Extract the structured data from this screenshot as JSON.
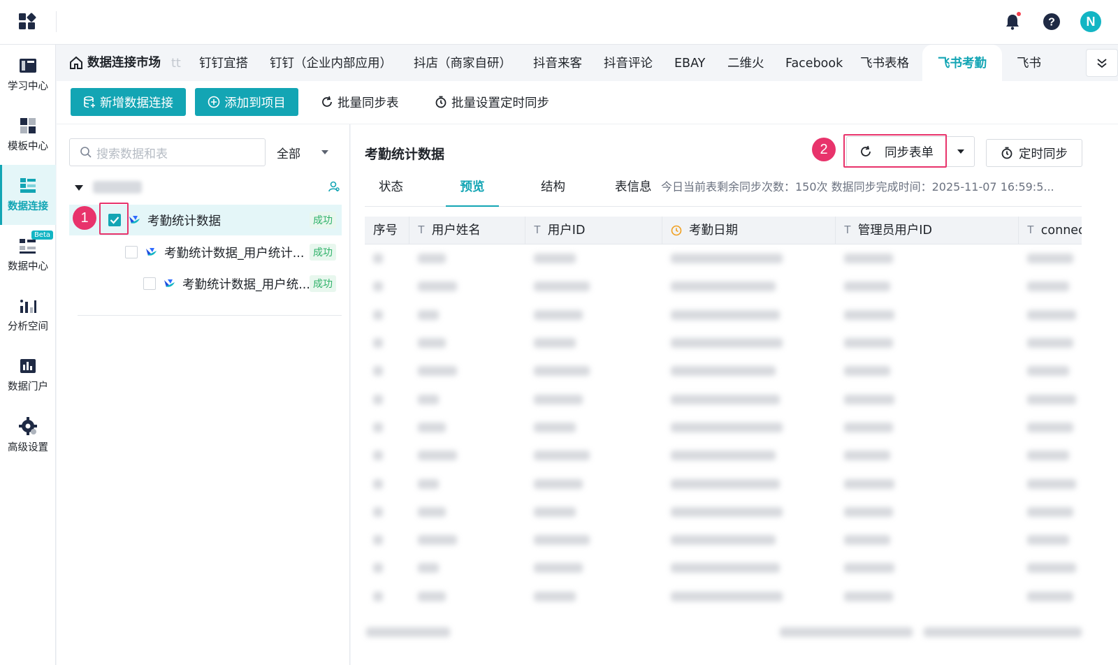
{
  "top": {
    "avatar_letter": "N"
  },
  "sidebar": {
    "items": [
      {
        "label": "学习中心",
        "icon": "book-icon"
      },
      {
        "label": "模板中心",
        "icon": "template-icon"
      },
      {
        "label": "数据连接",
        "icon": "connect-icon",
        "active": true
      },
      {
        "label": "数据中心",
        "icon": "data-center-icon",
        "badge": "Beta"
      },
      {
        "label": "分析空间",
        "icon": "analysis-icon"
      },
      {
        "label": "数据门户",
        "icon": "portal-icon"
      },
      {
        "label": "高级设置",
        "icon": "settings-icon"
      }
    ]
  },
  "tabs": [
    "数据连接市场",
    "钉钉宜搭",
    "钉钉（企业内部应用）",
    "抖店（商家自研）",
    "抖音来客",
    "抖音评论",
    "EBAY",
    "二维火",
    "Facebook",
    "飞书表格",
    "飞书考勤",
    "飞书"
  ],
  "tab_fragment": "tt",
  "toolbar": {
    "new_connection": "新增数据连接",
    "add_to_project": "添加到项目",
    "batch_sync": "批量同步表",
    "batch_timer": "批量设置定时同步"
  },
  "left": {
    "search_placeholder": "搜索数据和表",
    "filter": "全部",
    "items": [
      {
        "name": "考勤统计数据",
        "status": "成功"
      },
      {
        "name": "考勤统计数据_用户统计...",
        "status": "成功"
      },
      {
        "name": "考勤统计数据_用户统...",
        "status": "成功"
      }
    ]
  },
  "markers": {
    "one": "1",
    "two": "2"
  },
  "right": {
    "title": "考勤统计数据",
    "sync_button": "同步表单",
    "timer_button": "定时同步",
    "subtabs": [
      "状态",
      "预览",
      "结构"
    ],
    "active_subtab": "预览",
    "table_info_label": "表信息",
    "table_info_meta": "今日当前表剩余同步次数：150次    数据同步完成时间：2025-11-07 16:59:5...",
    "columns": [
      {
        "label": "序号",
        "type": ""
      },
      {
        "label": "用户姓名",
        "type": "T"
      },
      {
        "label": "用户ID",
        "type": "T"
      },
      {
        "label": "考勤日期",
        "type": "clock"
      },
      {
        "label": "管理员用户ID",
        "type": "T"
      },
      {
        "label": "connec",
        "type": "T"
      }
    ]
  },
  "colors": {
    "accent": "#13a5b4",
    "marker": "#e8336b",
    "success": "#2fb269"
  }
}
